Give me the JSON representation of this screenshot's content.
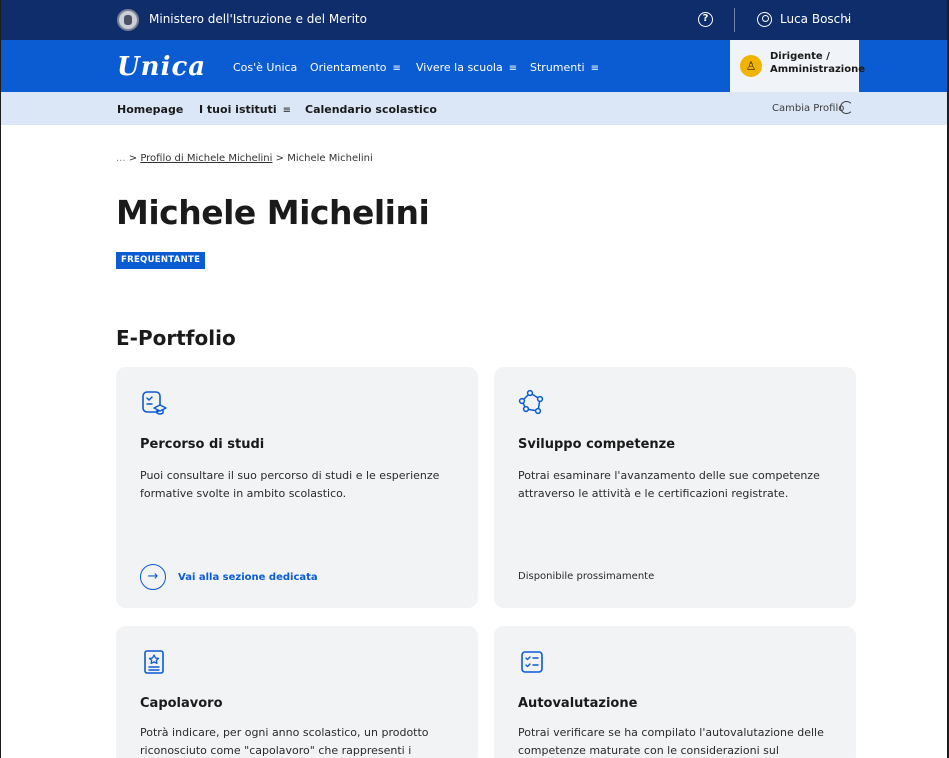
{
  "topbar": {
    "ministry": "Ministero dell'Istruzione e del Merito",
    "user_name": "Luca Boschi",
    "help_glyph": "?",
    "chevron": "⌄"
  },
  "mainnav": {
    "logo": "Unica",
    "items": [
      {
        "label": "Cos'è Unica",
        "menu": false
      },
      {
        "label": "Orientamento",
        "menu": true
      },
      {
        "label": "Vivere la scuola",
        "menu": true
      },
      {
        "label": "Strumenti",
        "menu": true
      }
    ],
    "burger": "≡",
    "role": {
      "line1": "Dirigente /",
      "line2": "Amministrazione"
    }
  },
  "subnav": {
    "items": [
      {
        "label": "Homepage"
      },
      {
        "label": "I tuoi istituti"
      },
      {
        "label": "Calendario scolastico"
      }
    ],
    "cambia_profilo": "Cambia Profilo"
  },
  "breadcrumb": {
    "ellipsis": "...",
    "sep": ">",
    "link": "Profilo di Michele Michelini",
    "current": "Michele Michelini"
  },
  "page": {
    "title": "Michele Michelini",
    "badge": "FREQUENTANTE",
    "section_title": "E-Portfolio"
  },
  "cards": [
    {
      "icon": "learning-path-icon",
      "title": "Percorso di studi",
      "desc": "Puoi consultare il suo percorso di studi e le esperienze formative svolte in ambito scolastico.",
      "link": "Vai alla sezione dedicata",
      "link_arrow": "→"
    },
    {
      "icon": "network-nodes-icon",
      "title": "Sviluppo competenze",
      "desc": "Potrai esaminare l'avanzamento delle sue competenze attraverso le attività e le certificazioni registrate.",
      "note": "Disponibile prossimamente"
    },
    {
      "icon": "masterpiece-icon",
      "title": "Capolavoro",
      "desc": "Potrà indicare, per ogni anno scolastico, un prodotto riconosciuto come \"capolavoro\" che rappresenti i"
    },
    {
      "icon": "checklist-icon",
      "title": "Autovalutazione",
      "desc": "Potrai verificare se ha compilato l'autovalutazione delle competenze maturate con le considerazioni sul"
    }
  ],
  "colors": {
    "topbar": "#0f2d6b",
    "primary": "#0b5bd3",
    "subnav": "#dbe7f7",
    "card": "#f2f3f5",
    "role_avatar": "#f0b400"
  }
}
